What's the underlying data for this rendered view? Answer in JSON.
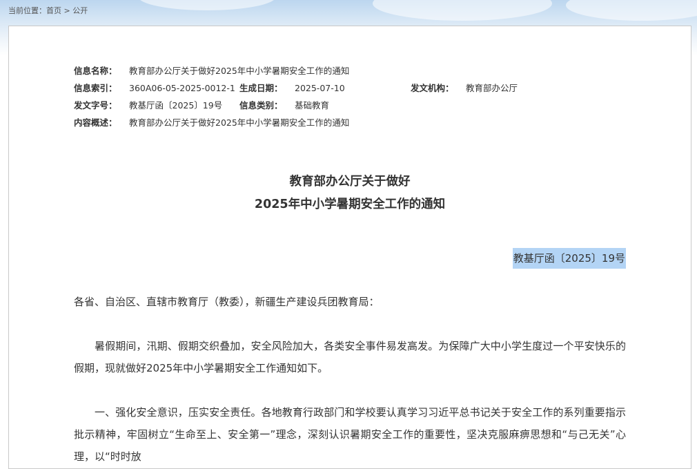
{
  "breadcrumb": {
    "label": "当前位置：",
    "home": "首页",
    "separator": ">",
    "current": "公开"
  },
  "meta": {
    "name_key": "信息名称：",
    "name_value": "教育部办公厅关于做好2025年中小学暑期安全工作的通知",
    "index_key": "信息索引：",
    "index_value": "360A06-05-2025-0012-1",
    "date_key": "生成日期：",
    "date_value": "2025-07-10",
    "org_key": "发文机构：",
    "org_value": "教育部办公厅",
    "docno_key": "发文字号：",
    "docno_value": "教基厅函〔2025〕19号",
    "category_key": "信息类别：",
    "category_value": "基础教育",
    "summary_key": "内容概述：",
    "summary_value": "教育部办公厅关于做好2025年中小学暑期安全工作的通知"
  },
  "document": {
    "title_line1": "教育部办公厅关于做好",
    "title_line2": "2025年中小学暑期安全工作的通知",
    "number": "教基厅函〔2025〕19号",
    "salutation": "各省、自治区、直辖市教育厅（教委），新疆生产建设兵团教育局：",
    "paragraph1": "暑假期间，汛期、假期交织叠加，安全风险加大，各类安全事件易发高发。为保障广大中小学生度过一个平安快乐的假期，现就做好2025年中小学暑期安全工作通知如下。",
    "paragraph2": "一、强化安全意识，压实安全责任。各地教育行政部门和学校要认真学习习近平总书记关于安全工作的系列重要指示批示精神，牢固树立“生命至上、安全第一”理念，深刻认识暑期安全工作的重要性，坚决克服麻痹思想和“与己无关”心理，以“时时放"
  },
  "colors": {
    "text": "#333333",
    "border": "#c8c8c8",
    "highlight": "#b3d4f5",
    "sky": "#bcd6ef"
  }
}
